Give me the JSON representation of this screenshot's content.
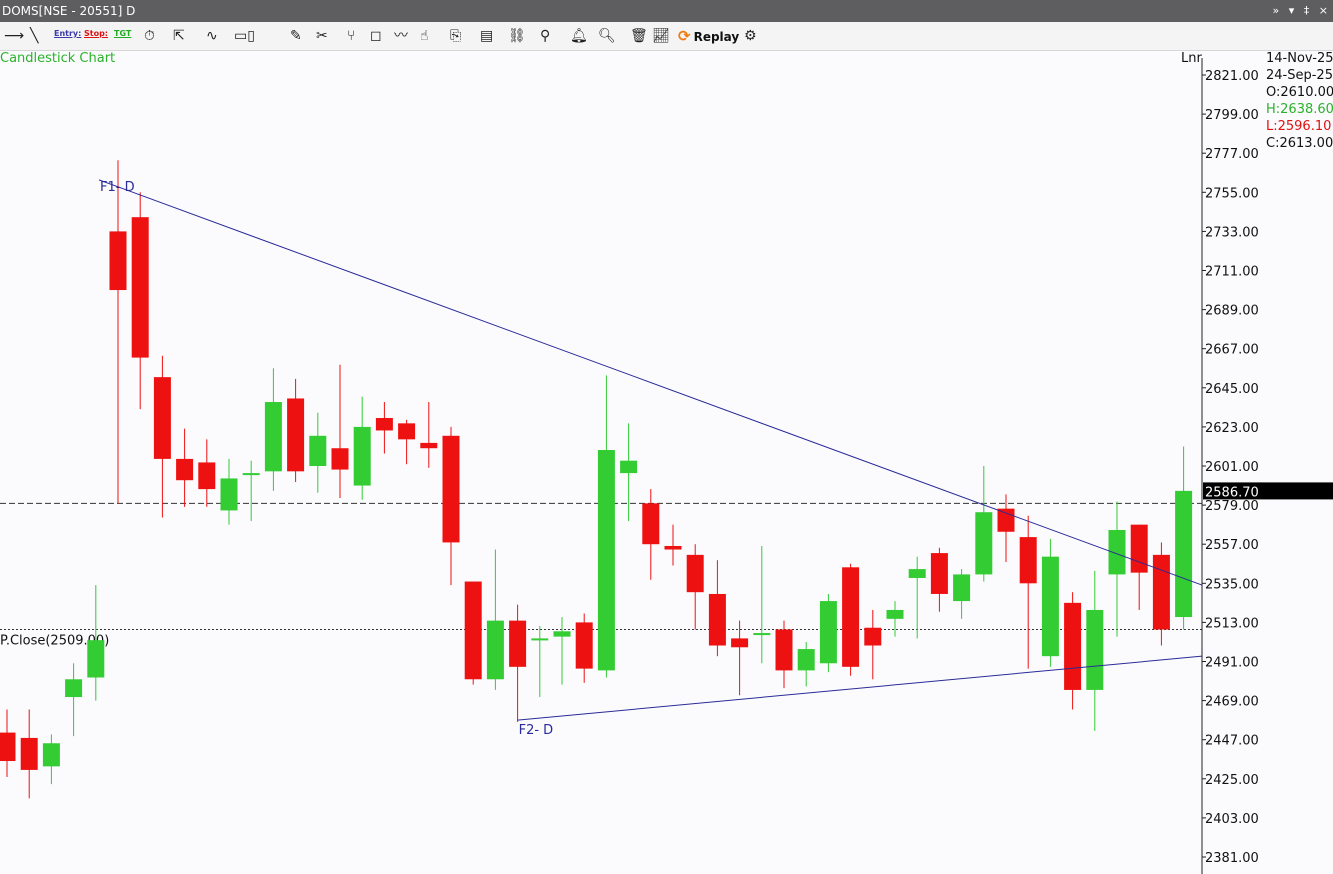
{
  "window": {
    "title": "DOMS[NSE - 20551] D",
    "controls": "» ▾ ‡ ×"
  },
  "toolbar": {
    "entry_label": "Entry:",
    "stop_label": "Stop:",
    "tgt_label": "TGT",
    "replay_label": "Replay"
  },
  "chart_title": "Candlestick Chart",
  "scale_label": "Lnr",
  "info": {
    "date1": "14-Nov-25",
    "date2": "24-Sep-25",
    "open": "O:2610.00",
    "high": "H:2638.60",
    "low": "L:2596.10",
    "close": "C:2613.00"
  },
  "colors": {
    "up": "#33cc33",
    "down": "#ee1111",
    "trend": "#2a2a99",
    "text_up": "#2ab22a",
    "text_down": "#e01010"
  },
  "chart_data": {
    "type": "candlestick",
    "title": "Candlestick Chart",
    "ylim": [
      2381,
      2827
    ],
    "yticks": [
      "2821.00",
      "2799.00",
      "2777.00",
      "2755.00",
      "2733.00",
      "2711.00",
      "2689.00",
      "2667.00",
      "2645.00",
      "2623.00",
      "2601.00",
      "2579.00",
      "2557.00",
      "2535.00",
      "2513.00",
      "2491.00",
      "2469.00",
      "2447.00",
      "2425.00",
      "2403.00",
      "2381.00"
    ],
    "last_price": "2586.70",
    "prev_close": {
      "label": "P.Close(2509.00)",
      "value": 2509
    },
    "current_line": 2580,
    "candles": [
      {
        "o": 2451,
        "h": 2464,
        "l": 2426,
        "c": 2435
      },
      {
        "o": 2448,
        "h": 2464,
        "l": 2414,
        "c": 2430
      },
      {
        "o": 2432,
        "h": 2450,
        "l": 2422,
        "c": 2445
      },
      {
        "o": 2471,
        "h": 2490,
        "l": 2449,
        "c": 2481
      },
      {
        "o": 2482,
        "h": 2534,
        "l": 2469,
        "c": 2503
      },
      {
        "o": 2733,
        "h": 2773,
        "l": 2580,
        "c": 2700
      },
      {
        "o": 2741,
        "h": 2755,
        "l": 2633,
        "c": 2662
      },
      {
        "o": 2651,
        "h": 2663,
        "l": 2572,
        "c": 2605
      },
      {
        "o": 2605,
        "h": 2622,
        "l": 2578,
        "c": 2593
      },
      {
        "o": 2603,
        "h": 2616,
        "l": 2578,
        "c": 2588
      },
      {
        "o": 2576,
        "h": 2605,
        "l": 2568,
        "c": 2594
      },
      {
        "o": 2597,
        "h": 2604,
        "l": 2570,
        "c": 2597
      },
      {
        "o": 2598,
        "h": 2656,
        "l": 2587,
        "c": 2637
      },
      {
        "o": 2639,
        "h": 2650,
        "l": 2592,
        "c": 2598
      },
      {
        "o": 2601,
        "h": 2631,
        "l": 2586,
        "c": 2618
      },
      {
        "o": 2611,
        "h": 2658,
        "l": 2583,
        "c": 2599
      },
      {
        "o": 2590,
        "h": 2640,
        "l": 2582,
        "c": 2623
      },
      {
        "o": 2628,
        "h": 2637,
        "l": 2608,
        "c": 2621
      },
      {
        "o": 2625,
        "h": 2627,
        "l": 2602,
        "c": 2616
      },
      {
        "o": 2614,
        "h": 2637,
        "l": 2600,
        "c": 2611
      },
      {
        "o": 2618,
        "h": 2623,
        "l": 2534,
        "c": 2558
      },
      {
        "o": 2536,
        "h": 2534,
        "l": 2478,
        "c": 2481
      },
      {
        "o": 2481,
        "h": 2554,
        "l": 2475,
        "c": 2514
      },
      {
        "o": 2514,
        "h": 2523,
        "l": 2457,
        "c": 2488
      },
      {
        "o": 2504,
        "h": 2511,
        "l": 2471,
        "c": 2504
      },
      {
        "o": 2505,
        "h": 2516,
        "l": 2478,
        "c": 2508
      },
      {
        "o": 2513,
        "h": 2518,
        "l": 2479,
        "c": 2487
      },
      {
        "o": 2486,
        "h": 2652,
        "l": 2482,
        "c": 2610
      },
      {
        "o": 2597,
        "h": 2625,
        "l": 2570,
        "c": 2604
      },
      {
        "o": 2580,
        "h": 2588,
        "l": 2537,
        "c": 2557
      },
      {
        "o": 2556,
        "h": 2568,
        "l": 2545,
        "c": 2554
      },
      {
        "o": 2551,
        "h": 2557,
        "l": 2509,
        "c": 2530
      },
      {
        "o": 2529,
        "h": 2548,
        "l": 2494,
        "c": 2500
      },
      {
        "o": 2504,
        "h": 2514,
        "l": 2472,
        "c": 2499
      },
      {
        "o": 2507,
        "h": 2556,
        "l": 2490,
        "c": 2507
      },
      {
        "o": 2509,
        "h": 2514,
        "l": 2476,
        "c": 2486
      },
      {
        "o": 2486,
        "h": 2502,
        "l": 2477,
        "c": 2498
      },
      {
        "o": 2490,
        "h": 2529,
        "l": 2485,
        "c": 2525
      },
      {
        "o": 2544,
        "h": 2546,
        "l": 2483,
        "c": 2488
      },
      {
        "o": 2510,
        "h": 2520,
        "l": 2481,
        "c": 2500
      },
      {
        "o": 2515,
        "h": 2525,
        "l": 2505,
        "c": 2520
      },
      {
        "o": 2538,
        "h": 2550,
        "l": 2504,
        "c": 2543
      },
      {
        "o": 2552,
        "h": 2555,
        "l": 2519,
        "c": 2529
      },
      {
        "o": 2525,
        "h": 2543,
        "l": 2515,
        "c": 2540
      },
      {
        "o": 2540,
        "h": 2601,
        "l": 2536,
        "c": 2575
      },
      {
        "o": 2577,
        "h": 2585,
        "l": 2547,
        "c": 2564
      },
      {
        "o": 2561,
        "h": 2573,
        "l": 2487,
        "c": 2535
      },
      {
        "o": 2494,
        "h": 2560,
        "l": 2488,
        "c": 2550
      },
      {
        "o": 2524,
        "h": 2530,
        "l": 2464,
        "c": 2475
      },
      {
        "o": 2475,
        "h": 2542,
        "l": 2452,
        "c": 2520
      },
      {
        "o": 2540,
        "h": 2581,
        "l": 2505,
        "c": 2565
      },
      {
        "o": 2568,
        "h": 2559,
        "l": 2520,
        "c": 2541
      },
      {
        "o": 2551,
        "h": 2558,
        "l": 2500,
        "c": 2509
      },
      {
        "o": 2516,
        "h": 2612,
        "l": 2509,
        "c": 2587
      }
    ],
    "trendlines": [
      {
        "label": "F1- D",
        "from": {
          "i": 4,
          "y": 2762
        },
        "to": {
          "i": 53,
          "y": 2534
        }
      },
      {
        "label": "F2- D",
        "from": {
          "i": 23,
          "y": 2458
        },
        "to": {
          "i": 53,
          "y": 2494
        }
      }
    ]
  }
}
